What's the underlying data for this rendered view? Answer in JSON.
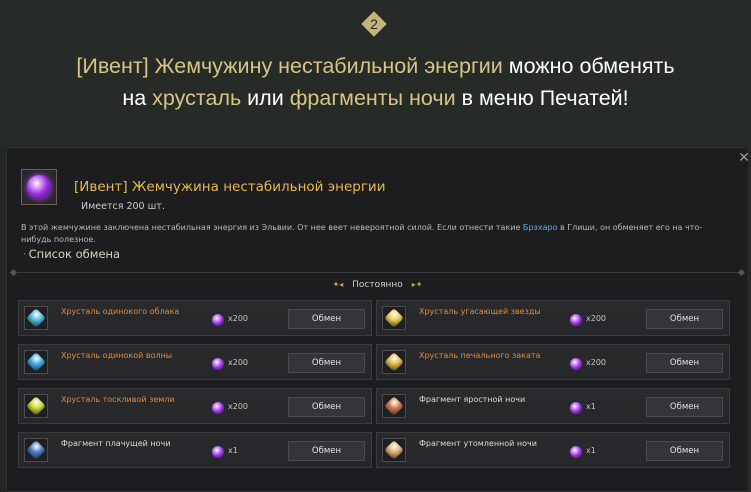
{
  "step_number": "2",
  "headline": {
    "line1": [
      {
        "text": "[Ивент] Жемчужину нестабильной энергии",
        "hl": true
      },
      {
        "text": " можно обменять",
        "hl": false
      }
    ],
    "line2": [
      {
        "text": "на ",
        "hl": false
      },
      {
        "text": "хрусталь",
        "hl": true
      },
      {
        "text": " или ",
        "hl": false
      },
      {
        "text": "фрагменты ночи",
        "hl": true
      },
      {
        "text": " в меню Печатей!",
        "hl": false
      }
    ]
  },
  "panel": {
    "close_glyph": "✕",
    "item": {
      "icon": "purple-pearl-icon",
      "title": "[Ивент] Жемчужина нестабильной энергии",
      "count": "Имеется 200 шт.",
      "desc_before": "В этой жемчужине заключена нестабильная энергия из Эльвии. От нее веет невероятной силой. Если отнести такие ",
      "desc_link": "Брэхаро",
      "desc_after": " в Глиши, он обменяет его на что-нибудь полезное."
    },
    "list_title": "Список обмена",
    "section": {
      "ornament_left": "✦◂",
      "label": "Постоянно",
      "ornament_right": "▸✦"
    },
    "exchange_button_label": "Обмен",
    "rows": [
      {
        "name": "Хрусталь одинокого облака",
        "cost": "x200",
        "style": "orange",
        "gem": "#4fb6e0"
      },
      {
        "name": "Хрусталь угасающей звезды",
        "cost": "x200",
        "style": "orange",
        "gem": "#e8c84a"
      },
      {
        "name": "Хрусталь одинокой волны",
        "cost": "x200",
        "style": "orange",
        "gem": "#3aa8e8"
      },
      {
        "name": "Хрусталь печального заката",
        "cost": "x200",
        "style": "orange",
        "gem": "#e0b840"
      },
      {
        "name": "Хрусталь тоскливой земли",
        "cost": "x200",
        "style": "orange",
        "gem": "#c8d630"
      },
      {
        "name": "Фрагмент яростной ночи",
        "cost": "x1",
        "style": "white",
        "gem": "#d0784a"
      },
      {
        "name": "Фрагмент плачущей ночи",
        "cost": "x1",
        "style": "white",
        "gem": "#4a78c8"
      },
      {
        "name": "Фрагмент утомленной ночи",
        "cost": "x1",
        "style": "white",
        "gem": "#d8b070"
      }
    ]
  }
}
